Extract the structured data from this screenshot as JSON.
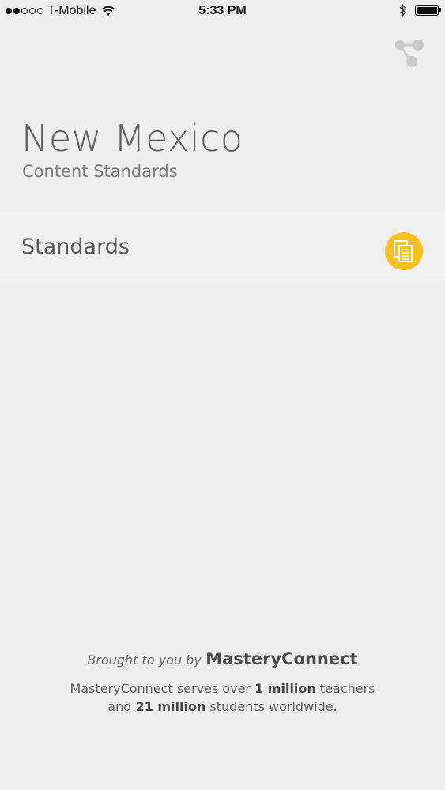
{
  "status_bar": {
    "carrier": "T-Mobile",
    "time": "5:33 PM",
    "signal_filled": 2,
    "signal_total": 5
  },
  "header": {
    "title": "New Mexico",
    "subtitle": "Content Standards",
    "share_icon": "share-icon"
  },
  "list": {
    "items": [
      {
        "label": "Standards",
        "icon": "document-stack-icon",
        "icon_color": "#f8c01f"
      }
    ]
  },
  "footer": {
    "brought_by": "Brought to you by",
    "brand": "MasteryConnect",
    "tagline_1": "MasteryConnect serves over",
    "tagline_2": "1 million",
    "tagline_3": "teachers",
    "tagline_4": "and",
    "tagline_5": "21 million",
    "tagline_6": "students worldwide."
  },
  "colors": {
    "background": "#efeeef",
    "accent": "#f8c01f",
    "divider": "#cfcfcf"
  }
}
